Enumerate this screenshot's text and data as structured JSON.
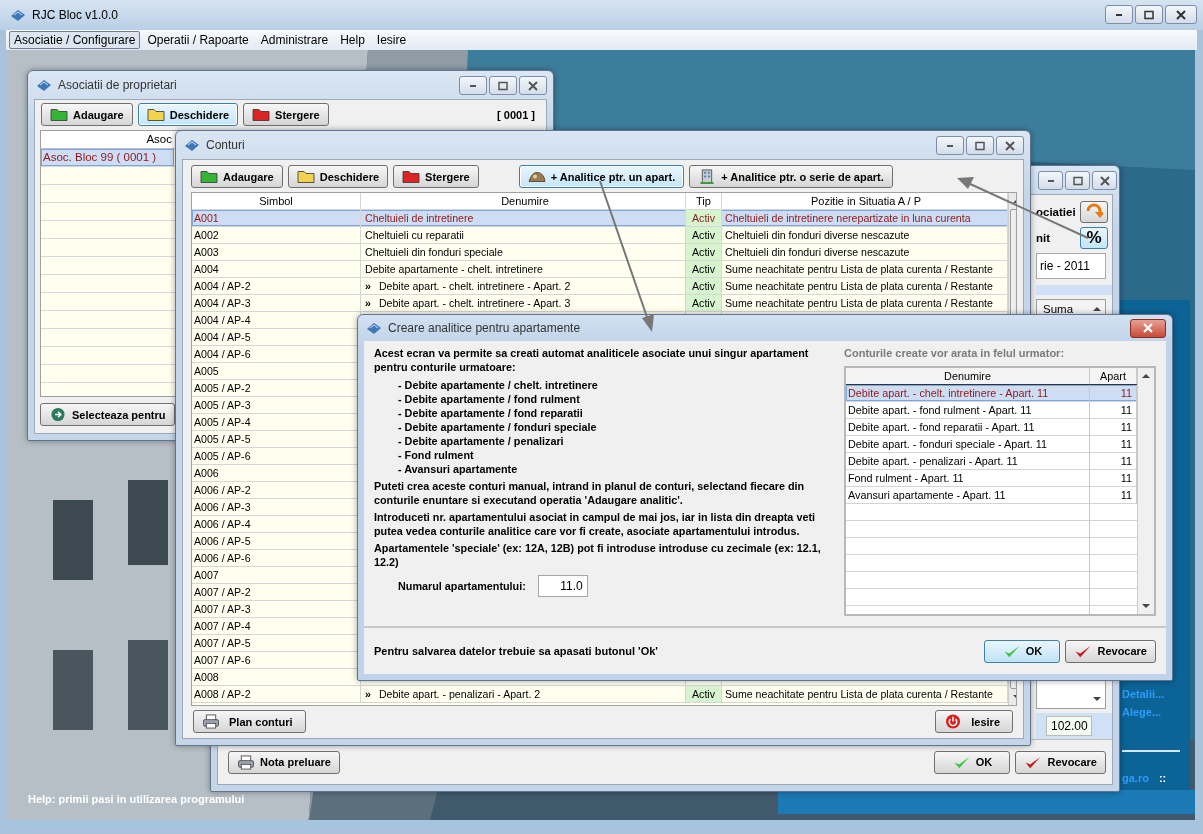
{
  "app": {
    "title": "RJC Bloc v1.0.0"
  },
  "menu": [
    {
      "label": "Asociatie / Configurare",
      "selected": true
    },
    {
      "label": "Operatii / Rapoarte",
      "selected": false
    },
    {
      "label": "Administrare",
      "selected": false
    },
    {
      "label": "Help",
      "selected": false
    },
    {
      "label": "Iesire",
      "selected": false
    }
  ],
  "help_text": "Help: primii pasi in utilizarea programului",
  "side_panel": {
    "links": [
      "Detalii...",
      "Alege..."
    ],
    "footer_link": "ga.ro",
    "footer_mark": "::"
  },
  "asociatii": {
    "title": "Asociatii de proprietari",
    "buttons": [
      {
        "label": "Adaugare",
        "kind": "add",
        "focused": false
      },
      {
        "label": "Deschidere",
        "kind": "open",
        "focused": true
      },
      {
        "label": "Stergere",
        "kind": "delete",
        "focused": false
      }
    ],
    "counter": "[ 0001 ]",
    "column": "Asoc",
    "rows": [
      {
        "name": "Asoc. Bloc 99 ( 0001 )",
        "selected": true
      }
    ],
    "select_button": "Selecteaza pentru"
  },
  "back_window": {
    "label_top": "ociatiei",
    "label_mid": "nit",
    "percent_button": "%",
    "period_field": "rie - 2011",
    "column": "Suma",
    "total": "102.00",
    "bottom_buttons": [
      {
        "label": "Nota preluare",
        "kind": "print"
      },
      {
        "label": "OK",
        "kind": "ok"
      },
      {
        "label": "Revocare",
        "kind": "cancel"
      }
    ]
  },
  "conturi": {
    "title": "Conturi",
    "buttons": [
      {
        "label": "Adaugare",
        "kind": "add",
        "focused": false
      },
      {
        "label": "Deschidere",
        "kind": "open",
        "focused": false
      },
      {
        "label": "Stergere",
        "kind": "delete",
        "focused": false
      },
      {
        "label": "+ Analitice ptr. un apart.",
        "kind": "single",
        "focused": true
      },
      {
        "label": "+ Analitice ptr. o serie de apart.",
        "kind": "series",
        "focused": false
      }
    ],
    "columns": [
      "Simbol",
      "Denumire",
      "Tip",
      "Pozitie in Situatia A / P"
    ],
    "rows": [
      {
        "simbol": "A001",
        "denumire": "Cheltuieli de intretinere",
        "tip": "Activ",
        "pozitie": "Cheltuieli de intretinere nerepartizate in luna curenta",
        "selected": true
      },
      {
        "simbol": "A002",
        "denumire": "Cheltuieli cu reparatii",
        "tip": "Activ",
        "pozitie": "Cheltuieli din fonduri diverse nescazute",
        "selected": false
      },
      {
        "simbol": "A003",
        "denumire": "Cheltuieli din fonduri speciale",
        "tip": "Activ",
        "pozitie": "Cheltuieli din fonduri diverse nescazute",
        "selected": false
      },
      {
        "simbol": "A004",
        "denumire": "Debite apartamente - chelt. intretinere",
        "tip": "Activ",
        "pozitie": "Sume neachitate pentru Lista de plata curenta / Restante",
        "selected": false
      },
      {
        "simbol": "A004 / AP-2",
        "marker": "»",
        "denumire": "Debite apart. - chelt. intretinere - Apart. 2",
        "tip": "Activ",
        "pozitie": "Sume neachitate pentru Lista de plata curenta / Restante",
        "selected": false
      },
      {
        "simbol": "A004 / AP-3",
        "marker": "»",
        "denumire": "Debite apart. - chelt. intretinere - Apart. 3",
        "tip": "Activ",
        "pozitie": "Sume neachitate pentru Lista de plata curenta / Restante",
        "selected": false
      },
      {
        "simbol": "A004 / AP-4",
        "selected": false
      },
      {
        "simbol": "A004 / AP-5",
        "selected": false
      },
      {
        "simbol": "A004 / AP-6",
        "selected": false
      },
      {
        "simbol": "A005",
        "selected": false
      },
      {
        "simbol": "A005 / AP-2",
        "selected": false
      },
      {
        "simbol": "A005 / AP-3",
        "selected": false
      },
      {
        "simbol": "A005 / AP-4",
        "selected": false
      },
      {
        "simbol": "A005 / AP-5",
        "selected": false
      },
      {
        "simbol": "A005 / AP-6",
        "selected": false
      },
      {
        "simbol": "A006",
        "selected": false
      },
      {
        "simbol": "A006 / AP-2",
        "selected": false
      },
      {
        "simbol": "A006 / AP-3",
        "selected": false
      },
      {
        "simbol": "A006 / AP-4",
        "selected": false
      },
      {
        "simbol": "A006 / AP-5",
        "selected": false
      },
      {
        "simbol": "A006 / AP-6",
        "selected": false
      },
      {
        "simbol": "A007",
        "selected": false
      },
      {
        "simbol": "A007 / AP-2",
        "selected": false
      },
      {
        "simbol": "A007 / AP-3",
        "selected": false
      },
      {
        "simbol": "A007 / AP-4",
        "selected": false
      },
      {
        "simbol": "A007 / AP-5",
        "selected": false
      },
      {
        "simbol": "A007 / AP-6",
        "selected": false
      },
      {
        "simbol": "A008",
        "selected": false
      },
      {
        "simbol": "A008 / AP-2",
        "marker": "»",
        "denumire": "Debite apart. - penalizari - Apart. 2",
        "tip": "Activ",
        "pozitie": "Sume neachitate pentru Lista de plata curenta / Restante",
        "selected": false
      }
    ],
    "footer_buttons": [
      {
        "label": "Plan conturi",
        "kind": "print"
      },
      {
        "label": "Iesire",
        "kind": "exit"
      }
    ]
  },
  "dialog": {
    "title": "Creare analitice pentru apartamente",
    "intro": "Acest ecran va permite sa creati automat analiticele asociate unui singur apartament pentru conturile urmatoare:",
    "accounts": [
      "- Debite apartamente / chelt. intretinere",
      "- Debite apartamente / fond rulment",
      "- Debite apartamente / fond reparatii",
      "- Debite apartamente / fonduri speciale",
      "- Debite apartamente / penalizari",
      "- Fond rulment",
      "- Avansuri apartamente"
    ],
    "paragraphs": [
      "Puteti crea aceste conturi manual, intrand in planul de conturi, selectand fiecare din conturile enuntare si executand operatia 'Adaugare analitic'.",
      "Introduceti nr. apartamentului asociat in campul de mai jos, iar in lista din dreapta veti putea vedea conturile analitice care vor fi create, asociate apartamentului introdus.",
      "Apartamentele 'speciale' (ex: 12A, 12B) pot fi introduse introduse cu zecimale  (ex: 12.1, 12.2)"
    ],
    "field_label": "Numarul apartamentului:",
    "field_value": "11.0",
    "save_note": "Pentru salvarea datelor trebuie sa apasati butonul 'Ok'",
    "preview_label": "Conturile create vor arata in felul urmator:",
    "preview_columns": [
      "Denumire",
      "Apart"
    ],
    "preview_rows": [
      {
        "denumire": "Debite apart. - chelt. intretinere - Apart. 11",
        "apart": "11",
        "selected": true
      },
      {
        "denumire": "Debite apart. - fond rulment - Apart. 11",
        "apart": "11",
        "selected": false
      },
      {
        "denumire": "Debite apart. - fond reparatii - Apart. 11",
        "apart": "11",
        "selected": false
      },
      {
        "denumire": "Debite apart. - fonduri speciale - Apart. 11",
        "apart": "11",
        "selected": false
      },
      {
        "denumire": "Debite apart. - penalizari - Apart. 11",
        "apart": "11",
        "selected": false
      },
      {
        "denumire": "Fond rulment - Apart. 11",
        "apart": "11",
        "selected": false
      },
      {
        "denumire": "Avansuri apartamente - Apart. 11",
        "apart": "11",
        "selected": false
      }
    ],
    "buttons": [
      {
        "label": "OK",
        "kind": "ok"
      },
      {
        "label": "Revocare",
        "kind": "cancel"
      }
    ]
  }
}
